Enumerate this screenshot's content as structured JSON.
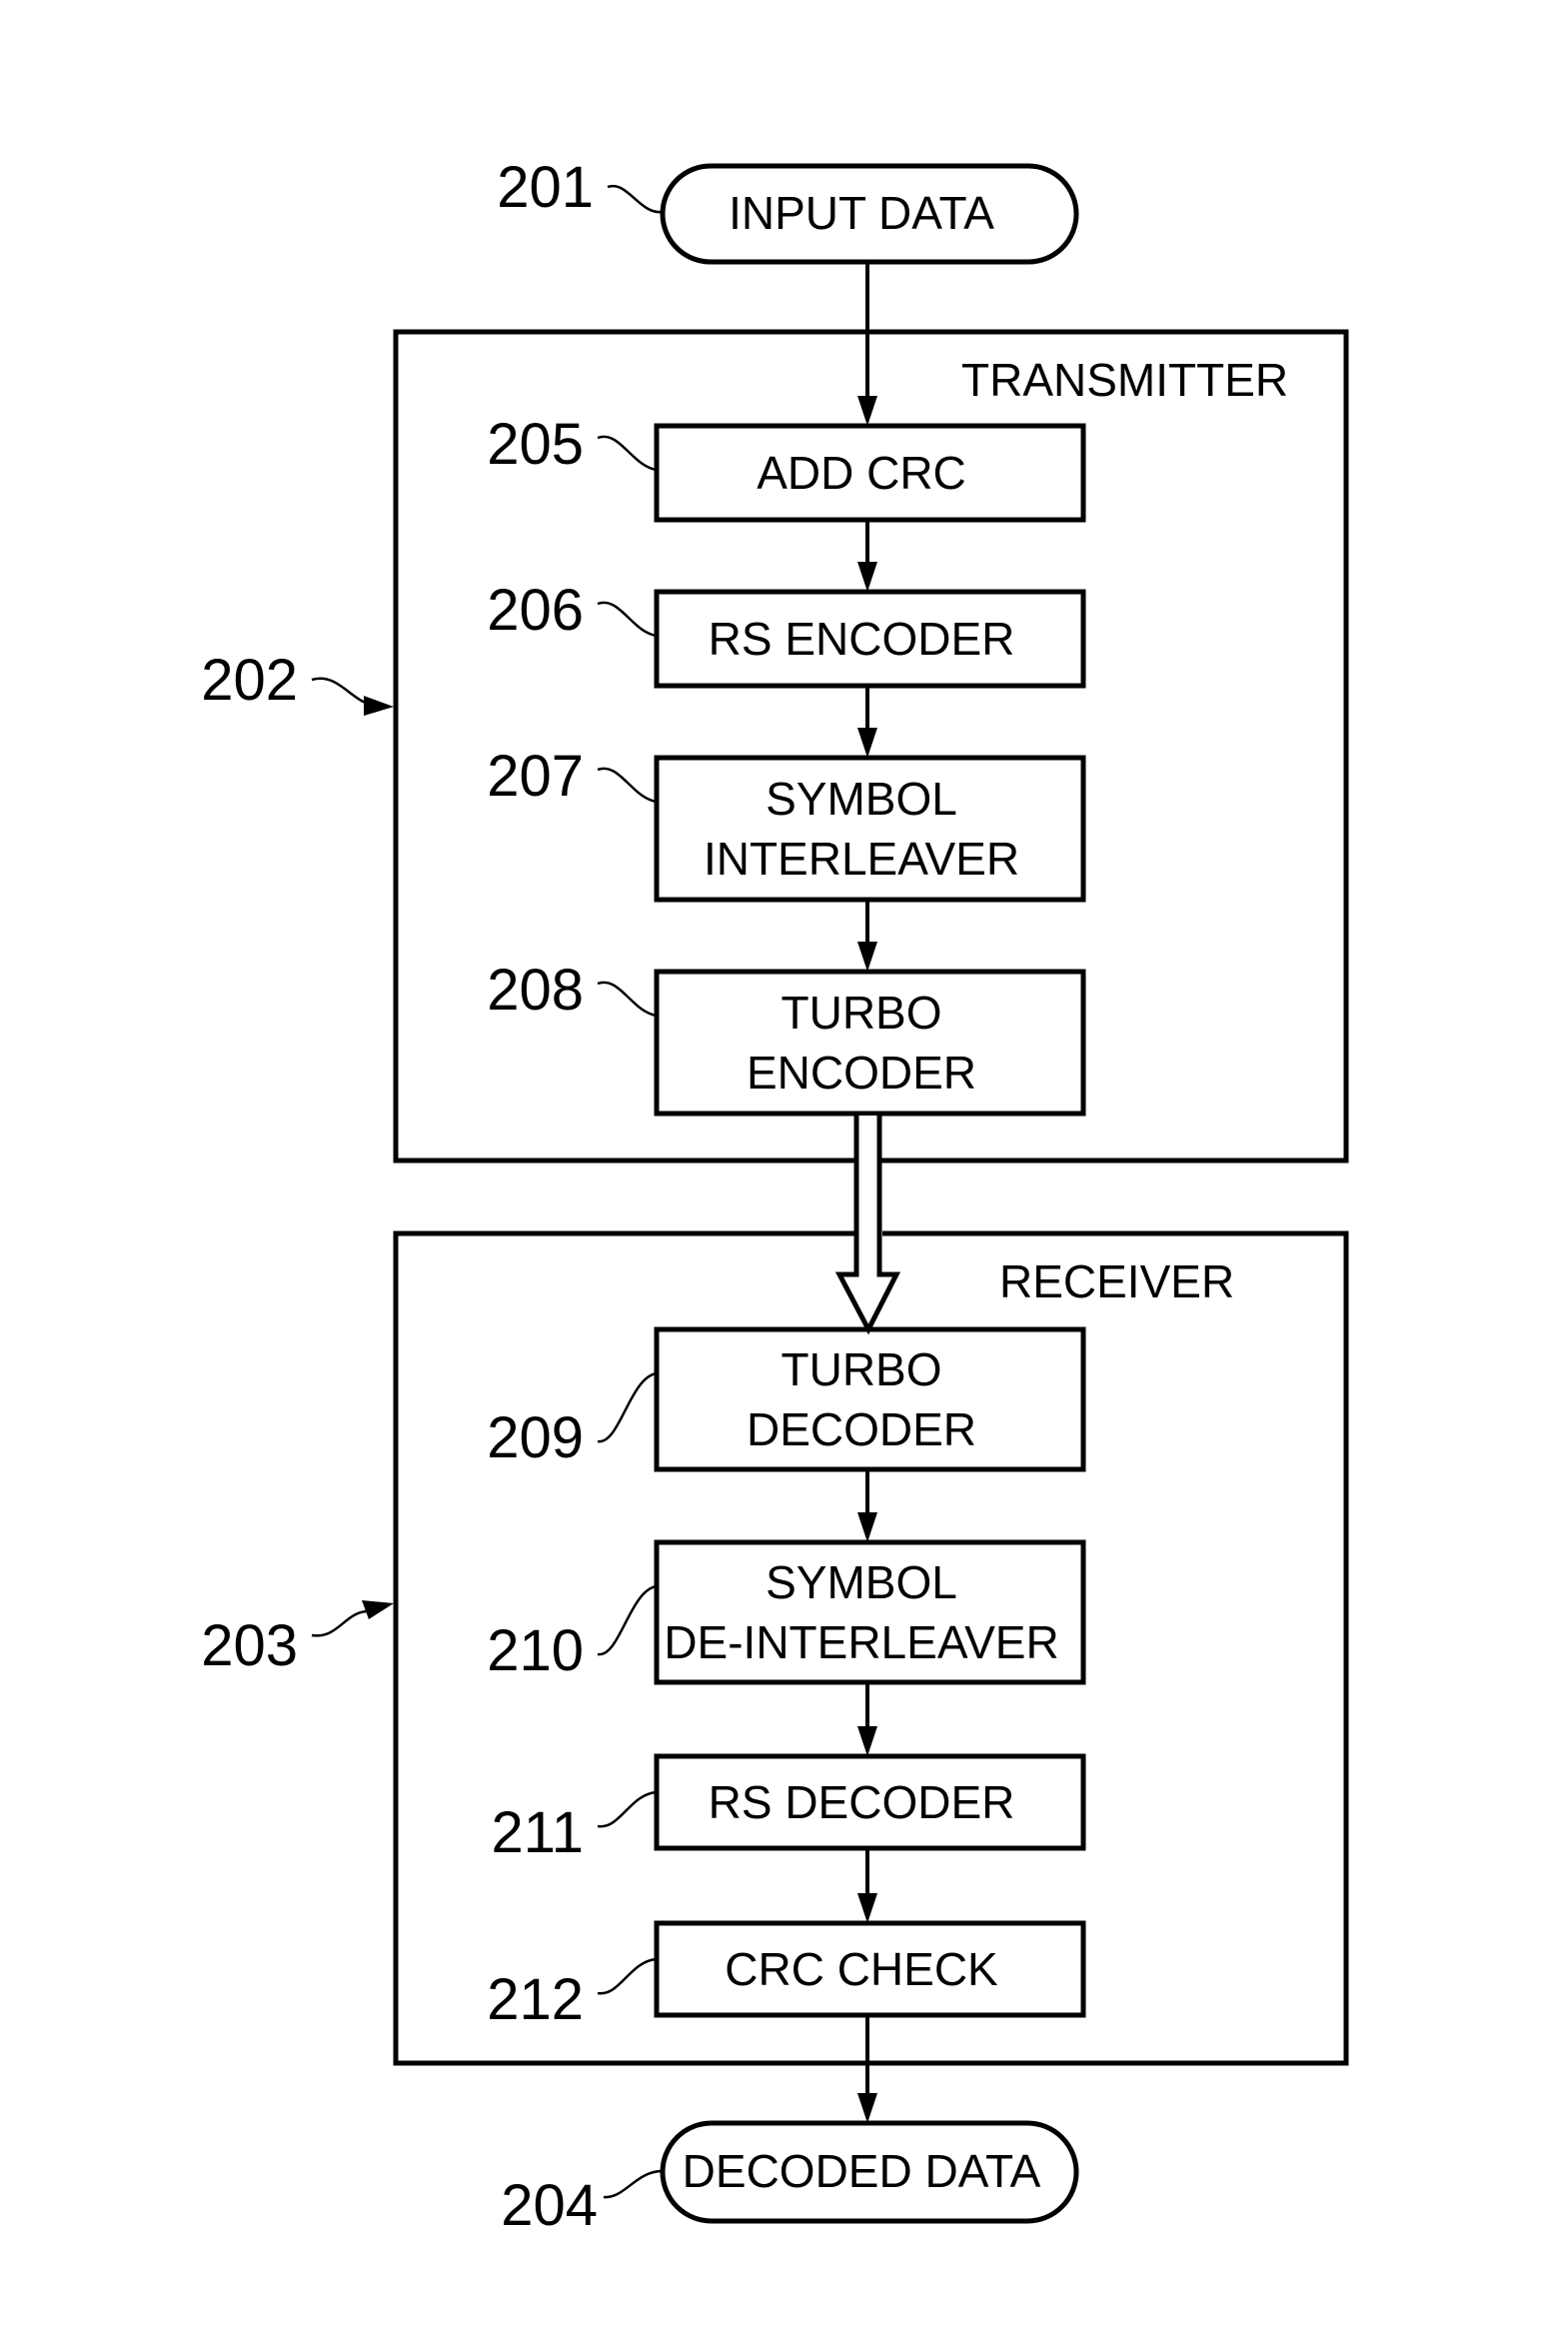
{
  "figure": {
    "terminals": {
      "input": {
        "ref": "201",
        "label": "INPUT DATA"
      },
      "output": {
        "ref": "204",
        "label": "DECODED DATA"
      }
    },
    "transmitter": {
      "ref": "202",
      "title": "TRANSMITTER",
      "blocks": [
        {
          "ref": "205",
          "lines": [
            "ADD CRC"
          ]
        },
        {
          "ref": "206",
          "lines": [
            "RS ENCODER"
          ]
        },
        {
          "ref": "207",
          "lines": [
            "SYMBOL",
            "INTERLEAVER"
          ]
        },
        {
          "ref": "208",
          "lines": [
            "TURBO",
            "ENCODER"
          ]
        }
      ]
    },
    "receiver": {
      "ref": "203",
      "title": "RECEIVER",
      "blocks": [
        {
          "ref": "209",
          "lines": [
            "TURBO",
            "DECODER"
          ]
        },
        {
          "ref": "210",
          "lines": [
            "SYMBOL",
            "DE-INTERLEAVER"
          ]
        },
        {
          "ref": "211",
          "lines": [
            "RS DECODER"
          ]
        },
        {
          "ref": "212",
          "lines": [
            "CRC CHECK"
          ]
        }
      ]
    }
  }
}
